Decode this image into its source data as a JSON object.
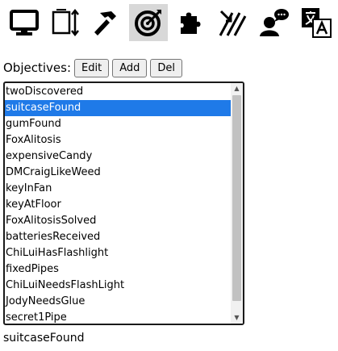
{
  "toolbar": {
    "tools": [
      {
        "icon": "monitor-icon",
        "selected": false
      },
      {
        "icon": "resize-icon",
        "selected": false
      },
      {
        "icon": "hammer-icon",
        "selected": false
      },
      {
        "icon": "target-icon",
        "selected": true
      },
      {
        "icon": "puzzle-icon",
        "selected": false
      },
      {
        "icon": "slash-arrow-icon",
        "selected": false
      },
      {
        "icon": "speaking-person-icon",
        "selected": false
      },
      {
        "icon": "translate-icon",
        "selected": false
      }
    ]
  },
  "objectives": {
    "label": "Objectives:",
    "edit_label": "Edit",
    "add_label": "Add",
    "del_label": "Del",
    "items": [
      "twoDiscovered",
      "suitcaseFound",
      "gumFound",
      "FoxAlitosis",
      "expensiveCandy",
      "DMCraigLikeWeed",
      "keyInFan",
      "keyAtFloor",
      "FoxAlitosisSolved",
      "batteriesReceived",
      "ChiLuiHasFlashlight",
      "fixedPipes",
      "ChiLuiNeedsFlashLight",
      "JodyNeedsGlue",
      "secret1Pipe"
    ],
    "selected_index": 1,
    "selected_value": "suitcaseFound"
  },
  "colors": {
    "selection": "#1f7ae8",
    "toolbar_selected": "#d8d8d8"
  }
}
